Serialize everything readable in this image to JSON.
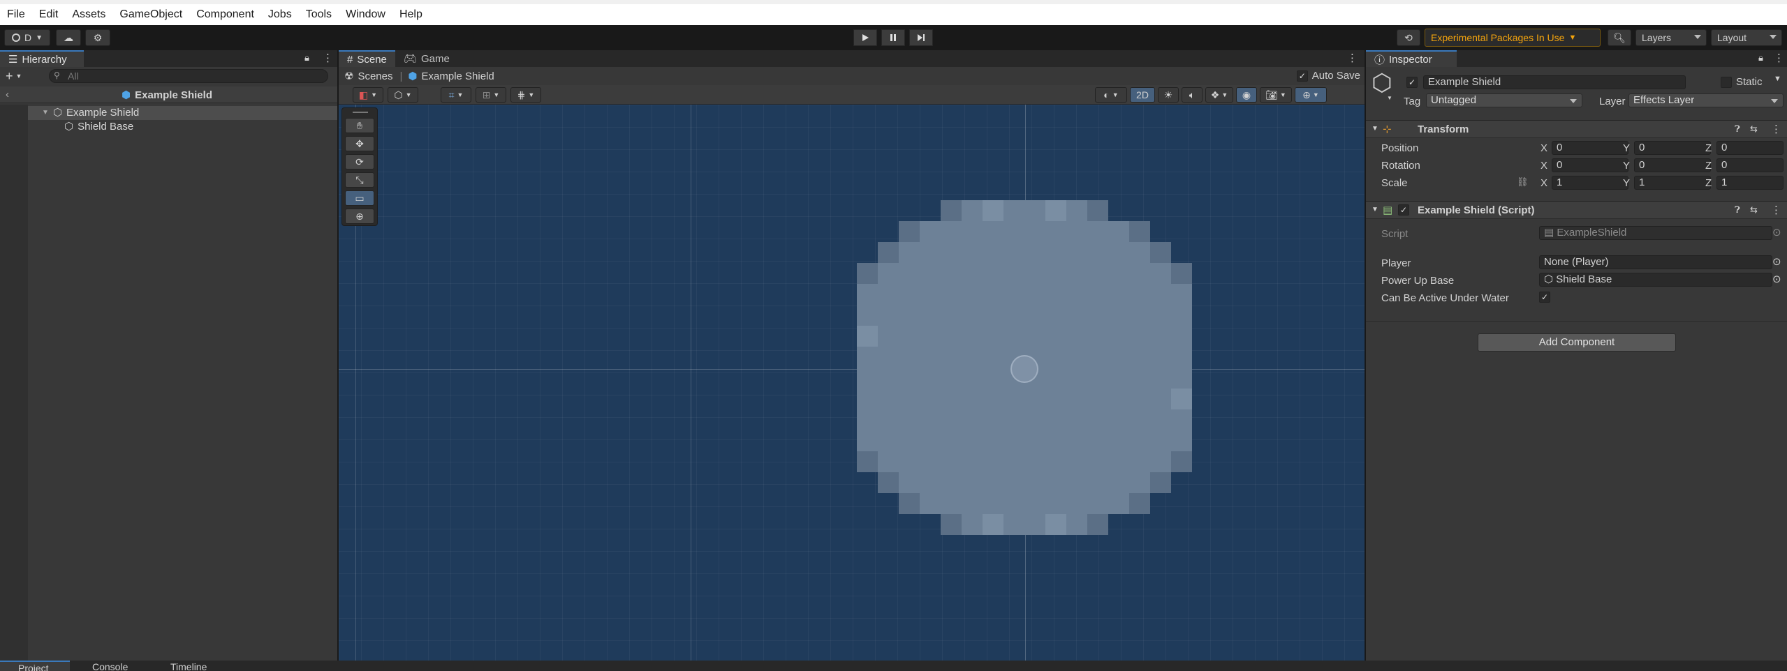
{
  "menu": [
    "File",
    "Edit",
    "Assets",
    "GameObject",
    "Component",
    "Jobs",
    "Tools",
    "Window",
    "Help"
  ],
  "toolbar": {
    "account_label": "D",
    "experimental_label": "Experimental Packages In Use",
    "layers_label": "Layers",
    "layout_label": "Layout"
  },
  "hierarchy": {
    "tab_label": "Hierarchy",
    "search_placeholder": "All",
    "scene_title": "Example Shield",
    "items": [
      {
        "label": "Example Shield"
      },
      {
        "label": "Shield Base"
      }
    ]
  },
  "scene": {
    "tabs": [
      "Scene",
      "Game"
    ],
    "breadcrumb_root": "Scenes",
    "breadcrumb_item": "Example Shield",
    "auto_save_label": "Auto Save",
    "mode_2d_label": "2D"
  },
  "inspector": {
    "tab_label": "Inspector",
    "object_name": "Example Shield",
    "static_label": "Static",
    "tag_label": "Tag",
    "tag_value": "Untagged",
    "layer_label": "Layer",
    "layer_value": "Effects Layer",
    "transform": {
      "title": "Transform",
      "rows": [
        {
          "label": "Position",
          "x": "0",
          "y": "0",
          "z": "0"
        },
        {
          "label": "Rotation",
          "x": "0",
          "y": "0",
          "z": "0"
        },
        {
          "label": "Scale",
          "x": "1",
          "y": "1",
          "z": "1"
        }
      ]
    },
    "script_component": {
      "title": "Example Shield (Script)",
      "script_label": "Script",
      "script_value": "ExampleShield",
      "player_label": "Player",
      "player_value": "None (Player)",
      "power_up_label": "Power Up Base",
      "power_up_value": "Shield Base",
      "under_water_label": "Can Be Active Under Water"
    },
    "add_component_label": "Add Component"
  },
  "bottom_tabs": [
    "Project",
    "Console",
    "Timeline"
  ],
  "colors": {
    "scene_bg": "#1f3b5b",
    "shield_fill": "#6d8197",
    "accent": "#3a79bb",
    "experimental": "#f4a40d"
  }
}
